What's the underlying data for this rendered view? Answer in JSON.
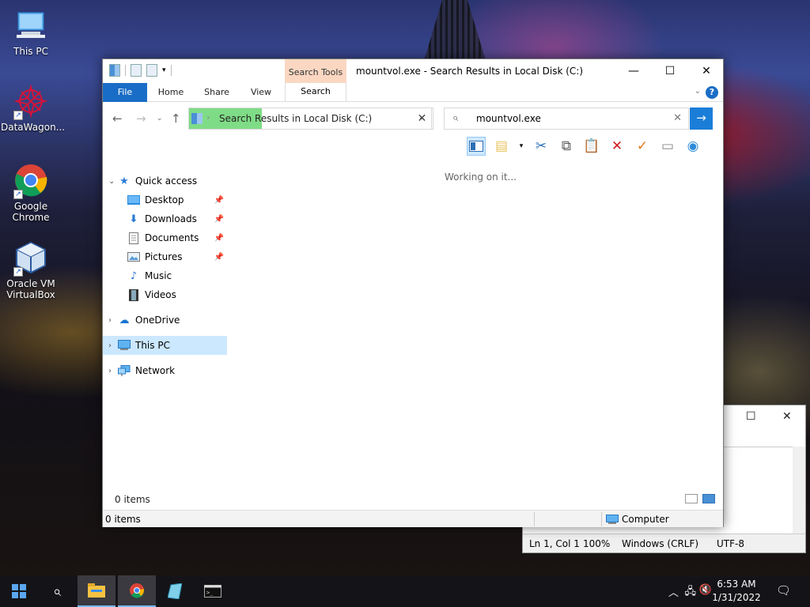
{
  "desktop": {
    "icons": [
      {
        "label": "This PC"
      },
      {
        "label": "DataWagon..."
      },
      {
        "label": "Google Chrome"
      },
      {
        "label": "Oracle VM VirtualBox"
      }
    ]
  },
  "explorer": {
    "title": "mountvol.exe - Search Results in Local Disk (C:)",
    "contextual_group": "Search Tools",
    "tabs": {
      "file": "File",
      "home": "Home",
      "share": "Share",
      "view": "View",
      "search": "Search"
    },
    "address": "Search Results in Local Disk (C:)",
    "search_value": "mountvol.exe",
    "working_message": "Working on it...",
    "nav": {
      "quick_access": "Quick access",
      "desktop": "Desktop",
      "downloads": "Downloads",
      "documents": "Documents",
      "pictures": "Pictures",
      "music": "Music",
      "videos": "Videos",
      "onedrive": "OneDrive",
      "this_pc": "This PC",
      "network": "Network"
    },
    "item_count": "0 items",
    "status_items": "0 items",
    "status_location": "Computer"
  },
  "notepad": {
    "position": "Ln 1, Col 1",
    "zoom": "100%",
    "line_endings": "Windows (CRLF)",
    "encoding": "UTF-8"
  },
  "taskbar": {
    "time": "6:53 AM",
    "date": "1/31/2022"
  }
}
